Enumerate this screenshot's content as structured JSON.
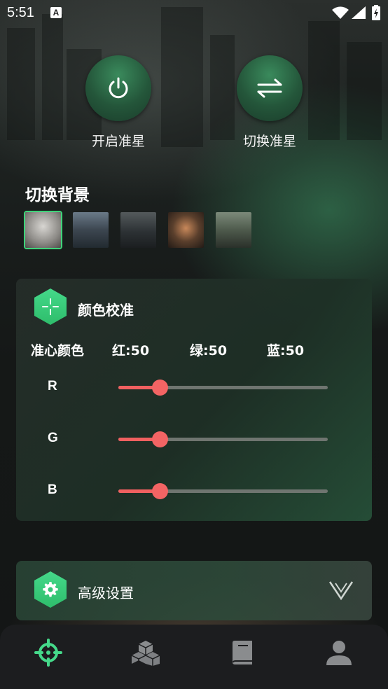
{
  "status_bar": {
    "time": "5:51",
    "notification_icon": "A"
  },
  "actions": {
    "aim_label": "开启准星",
    "switch_label": "切换准星"
  },
  "background": {
    "title": "切换背景",
    "selected_index": 0,
    "thumbnail_count": 5
  },
  "color_calibration": {
    "title": "颜色校准",
    "crosshair_color_label": "准心颜色",
    "red_label": "红:50",
    "green_label": "绿:50",
    "blue_label": "蓝:50",
    "sliders": [
      {
        "channel": "R",
        "value": 50,
        "max": 255
      },
      {
        "channel": "G",
        "value": 50,
        "max": 255
      },
      {
        "channel": "B",
        "value": 50,
        "max": 255
      }
    ]
  },
  "advanced": {
    "title": "高级设置"
  },
  "nav": {
    "items": [
      {
        "icon": "crosshair-icon",
        "active": true
      },
      {
        "icon": "blocks-icon",
        "active": false
      },
      {
        "icon": "book-icon",
        "active": false
      },
      {
        "icon": "profile-icon",
        "active": false
      }
    ]
  },
  "colors": {
    "accent_green": "#45d98a",
    "slider_red": "#f36464",
    "card_bg": "#1e3026"
  }
}
